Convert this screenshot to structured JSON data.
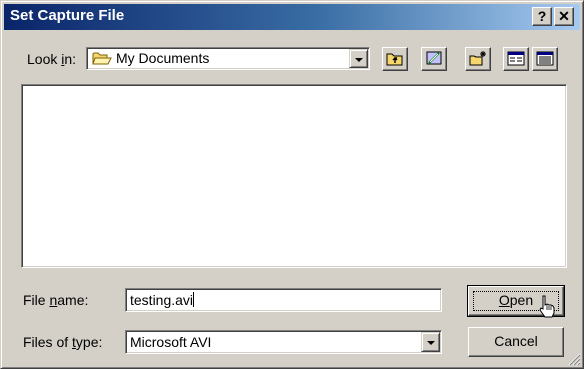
{
  "window": {
    "title": "Set Capture File",
    "help_label": "?",
    "close_label": "✕"
  },
  "look_in": {
    "label_before": "Look ",
    "label_accel": "i",
    "label_after": "n:",
    "value": "My Documents",
    "folder_icon": "folder-open-icon"
  },
  "toolbar": {
    "buttons": [
      "up-one-level-icon",
      "desktop-icon",
      "new-folder-icon",
      "list-view-icon",
      "details-view-icon"
    ]
  },
  "file_name": {
    "label_before": "File ",
    "label_accel": "n",
    "label_after": "ame:",
    "value": "testing.avi"
  },
  "file_type": {
    "label_before": "Files of ",
    "label_accel": "t",
    "label_after": "ype:",
    "value": "Microsoft AVI"
  },
  "buttons": {
    "open_accel": "O",
    "open_rest": "pen",
    "cancel": "Cancel"
  },
  "colors": {
    "title_gradient_start": "#0a246a",
    "title_gradient_end": "#a6caf0",
    "face": "#d4d0c8"
  }
}
